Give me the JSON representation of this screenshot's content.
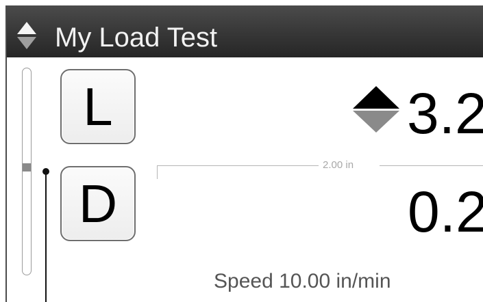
{
  "header": {
    "title": "My Load Test",
    "icon": "up-down-arrow-icon"
  },
  "buttons": {
    "load_label": "L",
    "displacement_label": "D"
  },
  "readings": {
    "load_value": "3.2",
    "load_icon": "up-down-arrow-icon",
    "displacement_value": "0.2"
  },
  "scale": {
    "label": "2.00 in"
  },
  "status": {
    "speed": "Speed 10.00 in/min"
  },
  "slider": {
    "level": 0.49
  },
  "colors": {
    "title_bar": "#2f2f2f",
    "title_text": "#f2f2f2",
    "scale": "#b5b5b5",
    "text": "#000000"
  }
}
